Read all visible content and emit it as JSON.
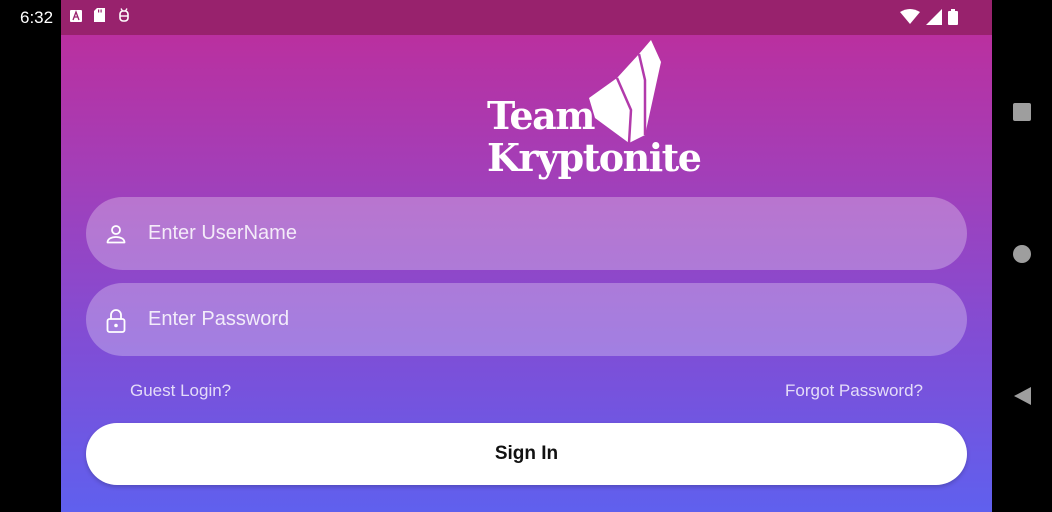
{
  "status_bar": {
    "time": "6:32",
    "left_icons": [
      "a-box-icon",
      "sd-card-icon",
      "android-debug-icon"
    ],
    "right_icons": [
      "wifi-icon",
      "signal-icon",
      "battery-icon"
    ]
  },
  "logo": {
    "line1": "Team",
    "line2": "Kryptonite"
  },
  "form": {
    "username_placeholder": "Enter UserName",
    "username_value": "",
    "password_placeholder": "Enter Password",
    "password_value": "",
    "guest_link": "Guest Login?",
    "forgot_link": "Forgot Password?",
    "signin_label": "Sign In"
  },
  "nav_bar": {
    "buttons": [
      "recents-icon",
      "home-icon",
      "back-icon"
    ]
  },
  "colors": {
    "gradient_top": "#c02c99",
    "gradient_bottom": "#5f60ee",
    "status_bar": "#98226d"
  }
}
